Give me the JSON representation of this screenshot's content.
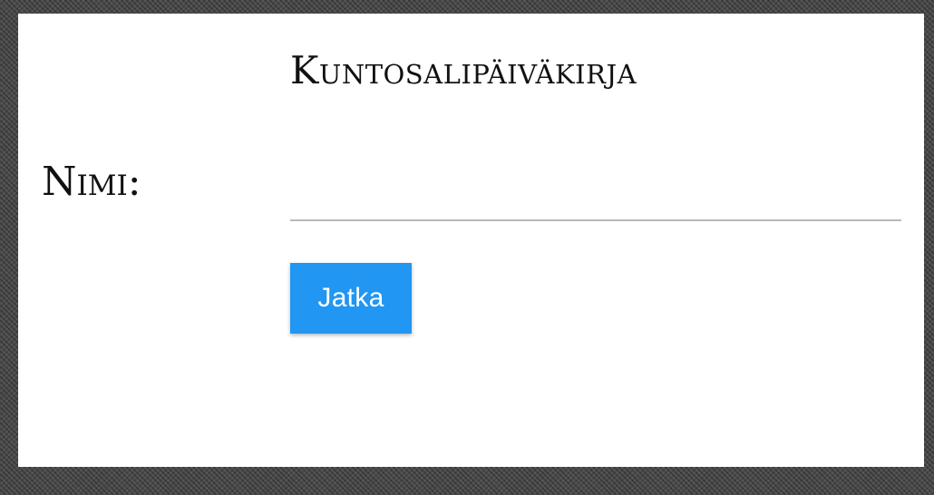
{
  "app": {
    "title": "Kuntosalipäiväkirja"
  },
  "form": {
    "name_label": "Nimi:",
    "name_value": "",
    "name_placeholder": "",
    "continue_label": "Jatka"
  },
  "colors": {
    "button_background": "#2196f3",
    "button_text": "#ffffff",
    "input_underline": "#b8b8b8",
    "card_background": "#ffffff",
    "page_background": "#4a4a4a"
  }
}
